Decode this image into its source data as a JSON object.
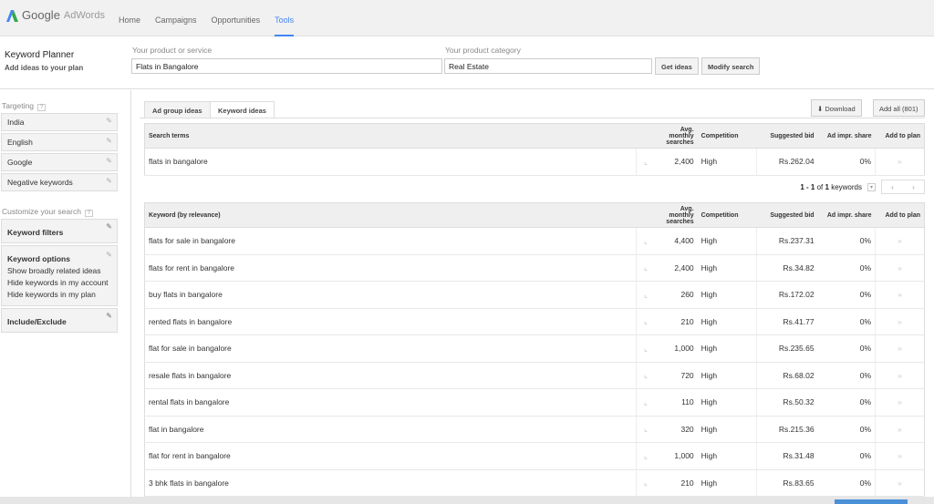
{
  "brand": {
    "google": "Google",
    "product": "AdWords"
  },
  "nav": [
    "Home",
    "Campaigns",
    "Opportunities",
    "Tools"
  ],
  "header": {
    "title": "Keyword Planner",
    "subtitle": "Add ideas to your plan",
    "product_label": "Your product or service",
    "product_value": "Flats in Bangalore",
    "category_label": "Your product category",
    "category_value": "Real Estate",
    "get_ideas": "Get ideas",
    "modify": "Modify search"
  },
  "sidebar": {
    "targeting": "Targeting",
    "targets": [
      "India",
      "English",
      "Google",
      "Negative keywords"
    ],
    "customize": "Customize your search",
    "filters": "Keyword filters",
    "options_title": "Keyword options",
    "options": [
      "Show broadly related ideas",
      "Hide keywords in my account",
      "Hide keywords in my plan"
    ],
    "include": "Include/Exclude",
    "help": "?"
  },
  "tabs": [
    "Ad group ideas",
    "Keyword ideas"
  ],
  "download": "Download",
  "add_all": "Add all (801)",
  "columns": {
    "search_terms": "Search terms",
    "keyword": "Keyword (by relevance)",
    "searches": "Avg. monthly searches",
    "competition": "Competition",
    "bid": "Suggested bid",
    "share": "Ad impr. share",
    "add": "Add to plan"
  },
  "search_row": {
    "kw": "flats in bangalore",
    "searches": "2,400",
    "comp": "High",
    "bid": "Rs.262.04",
    "share": "0%"
  },
  "pager": {
    "range": "1 - 1",
    "of": "of",
    "total": "1",
    "unit": "keywords"
  },
  "rows": [
    {
      "kw": "flats for sale in bangalore",
      "searches": "4,400",
      "comp": "High",
      "bid": "Rs.237.31",
      "share": "0%"
    },
    {
      "kw": "flats for rent in bangalore",
      "searches": "2,400",
      "comp": "High",
      "bid": "Rs.34.82",
      "share": "0%"
    },
    {
      "kw": "buy flats in bangalore",
      "searches": "260",
      "comp": "High",
      "bid": "Rs.172.02",
      "share": "0%"
    },
    {
      "kw": "rented flats in bangalore",
      "searches": "210",
      "comp": "High",
      "bid": "Rs.41.77",
      "share": "0%"
    },
    {
      "kw": "flat for sale in bangalore",
      "searches": "1,000",
      "comp": "High",
      "bid": "Rs.235.65",
      "share": "0%"
    },
    {
      "kw": "resale flats in bangalore",
      "searches": "720",
      "comp": "High",
      "bid": "Rs.68.02",
      "share": "0%"
    },
    {
      "kw": "rental flats in bangalore",
      "searches": "110",
      "comp": "High",
      "bid": "Rs.50.32",
      "share": "0%"
    },
    {
      "kw": "flat in bangalore",
      "searches": "320",
      "comp": "High",
      "bid": "Rs.215.36",
      "share": "0%"
    },
    {
      "kw": "flat for rent in bangalore",
      "searches": "1,000",
      "comp": "High",
      "bid": "Rs.31.48",
      "share": "0%"
    },
    {
      "kw": "3 bhk flats in bangalore",
      "searches": "210",
      "comp": "High",
      "bid": "Rs.83.65",
      "share": "0%"
    }
  ]
}
